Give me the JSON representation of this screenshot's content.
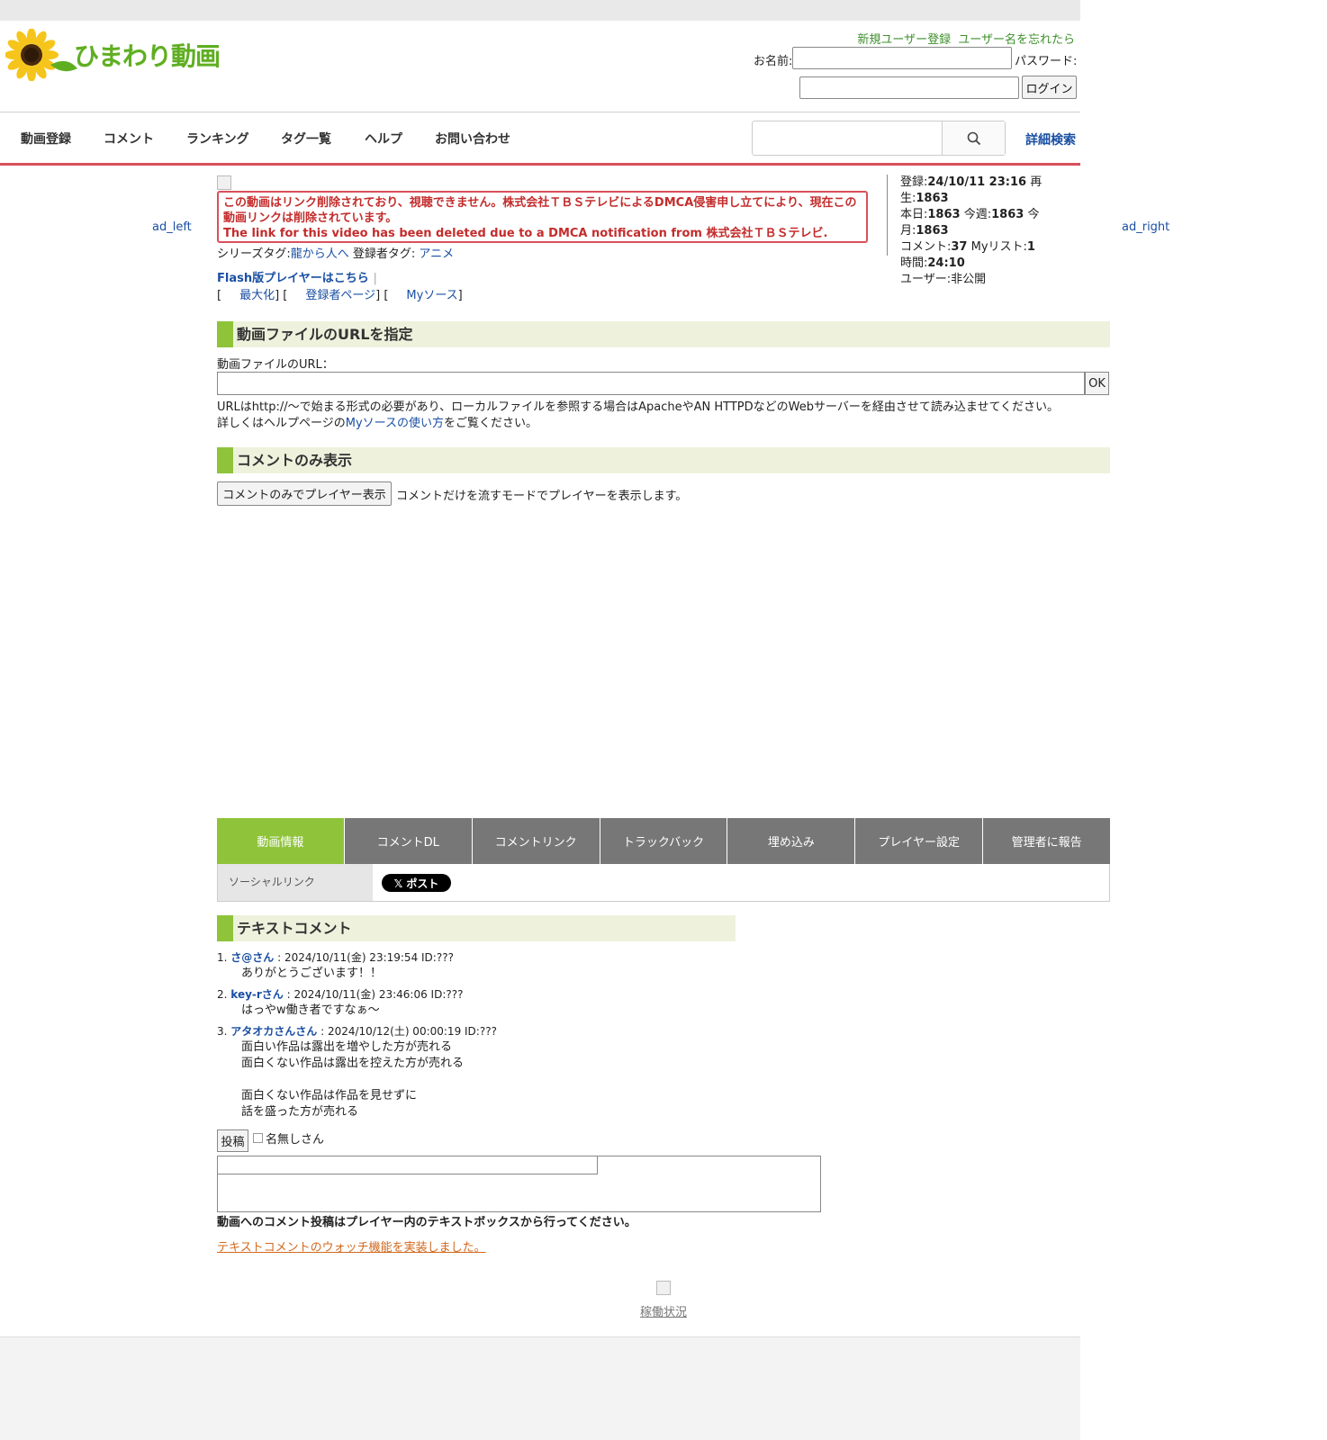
{
  "site": {
    "logo_text": "ひまわり動画"
  },
  "auth": {
    "register_link": "新規ユーザー登録",
    "forgot_link": "ユーザー名を忘れたら",
    "name_label": "お名前:",
    "password_label": "パスワード:",
    "login_button": "ログイン"
  },
  "nav": {
    "items": [
      "動画登録",
      "コメント",
      "ランキング",
      "タグ一覧",
      "ヘルプ",
      "お問い合わせ"
    ],
    "advanced_search": "詳細検索"
  },
  "ads": {
    "left": "ad_left",
    "right": "ad_right"
  },
  "notice": {
    "ja": "この動画はリンク削除されており、視聴できません。株式会社ＴＢＳテレビによるDMCA侵害申し立てにより、現在この動画リンクは削除されています。",
    "en": "The link for this video has been deleted due to a DMCA notification from 株式会社ＴＢＳテレビ."
  },
  "stats": {
    "registered_label": "登録:",
    "registered": "24/10/11 23:16",
    "plays_label": "再生:",
    "plays": "1863",
    "today_label": "本日:",
    "today": "1863",
    "week_label": "今週:",
    "week": "1863",
    "month_label": "今月:",
    "month": "1863",
    "comments_label": "コメント:",
    "comments": "37",
    "mylist_label": "Myリスト:",
    "mylist": "1",
    "duration_label": "時間:",
    "duration": "24:10",
    "user_label": "ユーザー:",
    "user": "非公開"
  },
  "tags": {
    "series_label": "シリーズタグ:",
    "series": "龍から人へ",
    "uploader_label": "登録者タグ:",
    "uploader": "アニメ"
  },
  "player_links": {
    "flash": "Flash版プレイヤーはこちら",
    "maximize": "最大化",
    "uploader_page": "登録者ページ",
    "mysource": "Myソース"
  },
  "url_section": {
    "heading": "動画ファイルのURLを指定",
    "label": "動画ファイルのURL：",
    "ok": "OK",
    "note_line1": "URLはhttp://〜で始まる形式の必要があり、ローカルファイルを参照する場合はApacheやAN HTTPDなどのWebサーバーを経由させて読み込ませてください。",
    "note_line2_pre": "詳しくはヘルプページの",
    "note_line2_link": "Myソースの使い方",
    "note_line2_post": "をご覧ください。"
  },
  "comment_only": {
    "heading": "コメントのみ表示",
    "button": "コメントのみでプレイヤー表示",
    "desc": "コメントだけを流すモードでプレイヤーを表示します。"
  },
  "tabs": [
    "動画情報",
    "コメントDL",
    "コメントリンク",
    "トラックバック",
    "埋め込み",
    "プレイヤー設定",
    "管理者に報告"
  ],
  "social": {
    "label": "ソーシャルリンク",
    "x_post": "𝕏 ポスト"
  },
  "text_comments": {
    "heading": "テキストコメント",
    "items": [
      {
        "num": "1.",
        "author": "さ@さん",
        "meta": " : 2024/10/11(金) 23:19:54 ID:???",
        "body": "ありがとうございます！！"
      },
      {
        "num": "2.",
        "author": "key-rさん",
        "meta": " : 2024/10/11(金) 23:46:06 ID:???",
        "body": "はっやw働き者ですなぁ〜"
      },
      {
        "num": "3.",
        "author": "アタオカさんさん",
        "meta": " : 2024/10/12(土) 00:00:19 ID:???",
        "body": "面白い作品は露出を増やした方が売れる\n面白くない作品は露出を控えた方が売れる\n\n面白くない作品は作品を見せずに\n話を盛った方が売れる"
      }
    ],
    "post_button": "投稿",
    "anon_label": "名無しさん",
    "note": "動画へのコメント投稿はプレイヤー内のテキストボックスから行ってください。",
    "watch_link": "テキストコメントのウォッチ機能を実装しました。"
  },
  "footer": {
    "status_link": "稼働状況"
  }
}
